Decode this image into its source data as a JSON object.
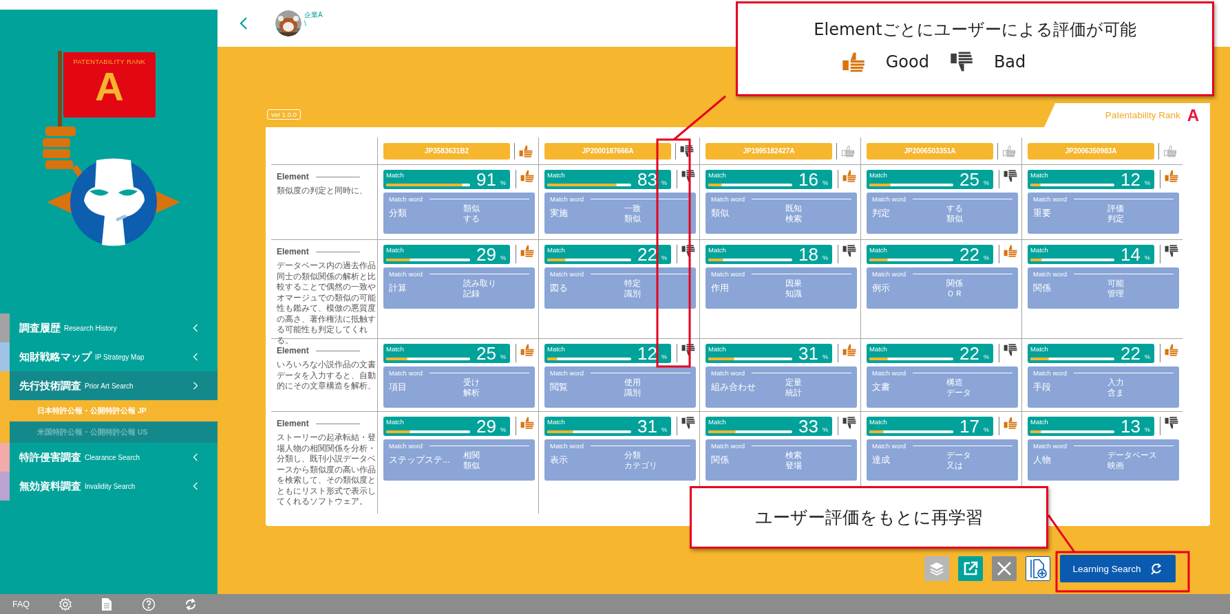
{
  "sidebar": {
    "logo": {
      "caption": "PATENTABILITY RANK",
      "letter": "A"
    },
    "menu": [
      {
        "label": "調査履歴",
        "sublabel": "Research History",
        "color": "#a3a3a3",
        "selected": false,
        "expanded": false
      },
      {
        "label": "知財戦略マップ",
        "sublabel": "IP Strategy Map",
        "color": "#9ec3e6",
        "selected": false,
        "expanded": false
      },
      {
        "label": "先行技術調査",
        "sublabel": "Prior Art Search",
        "color": "#f5b52e",
        "selected": true,
        "expanded": true,
        "children": [
          {
            "label": "日本特許公報・公開特許公報 JP",
            "selected": true
          },
          {
            "label": "米国特許公報・公開特許公報 US",
            "selected": false
          }
        ]
      },
      {
        "label": "特許侵害調査",
        "sublabel": "Clearance Search",
        "color": "#f2aaaa",
        "selected": false,
        "expanded": false
      },
      {
        "label": "無効資料調査",
        "sublabel": "Invalidity Search",
        "color": "#b9a4cf",
        "selected": false,
        "expanded": false
      }
    ]
  },
  "footer": {
    "faq": "FAQ"
  },
  "header": {
    "company": "企業A",
    "subtitle": "\\"
  },
  "version": "ver 1.0.0",
  "rank": {
    "label": "Patentability Rank",
    "letter": "A"
  },
  "patents": [
    {
      "number": "JP3583631B2",
      "good": true,
      "bad": false
    },
    {
      "number": "JP2000187666A",
      "good": false,
      "bad": true
    },
    {
      "number": "JP1995182427A",
      "good": false,
      "bad": false
    },
    {
      "number": "JP2006503351A",
      "good": false,
      "bad": false
    },
    {
      "number": "JP2006350983A",
      "good": false,
      "bad": false
    }
  ],
  "rows": [
    {
      "label": "Element",
      "description": "類似度の判定と同時に、",
      "cells": [
        {
          "match_label": "Match",
          "value": "91",
          "unit": "%",
          "level": 0.91,
          "good": true,
          "bad": false,
          "word_label": "Match word",
          "main": "分類",
          "words": [
            "類似",
            "する"
          ]
        },
        {
          "match_label": "Match",
          "value": "83",
          "unit": "%",
          "level": 0.83,
          "good": false,
          "bad": true,
          "word_label": "Match word",
          "main": "実施",
          "words": [
            "一致",
            "類似"
          ]
        },
        {
          "match_label": "Match",
          "value": "16",
          "unit": "%",
          "level": 0.16,
          "good": true,
          "bad": false,
          "word_label": "Match word",
          "main": "類似",
          "words": [
            "既知",
            "検索"
          ]
        },
        {
          "match_label": "Match",
          "value": "25",
          "unit": "%",
          "level": 0.25,
          "good": false,
          "bad": true,
          "word_label": "Match word",
          "main": "判定",
          "words": [
            "する",
            "類似"
          ]
        },
        {
          "match_label": "Match",
          "value": "12",
          "unit": "%",
          "level": 0.12,
          "good": true,
          "bad": false,
          "word_label": "Match word",
          "main": "重要",
          "words": [
            "評価",
            "判定"
          ]
        }
      ]
    },
    {
      "label": "Element",
      "description": "データベース内の過去作品同士の類似関係の解析と比較することで偶然の一致やオマージュでの類似の可能性も鑑みて、模倣の悪質度の高さ、著作権法に抵触する可能性も判定してくれる。",
      "cells": [
        {
          "match_label": "Match",
          "value": "29",
          "unit": "%",
          "level": 0.29,
          "good": true,
          "bad": false,
          "word_label": "Match word",
          "main": "計算",
          "words": [
            "読み取り",
            "記録"
          ]
        },
        {
          "match_label": "Match",
          "value": "22",
          "unit": "%",
          "level": 0.22,
          "good": false,
          "bad": true,
          "word_label": "Match word",
          "main": "図る",
          "words": [
            "特定",
            "識別"
          ]
        },
        {
          "match_label": "Match",
          "value": "18",
          "unit": "%",
          "level": 0.18,
          "good": false,
          "bad": true,
          "word_label": "Match word",
          "main": "作用",
          "words": [
            "因果",
            "知識"
          ]
        },
        {
          "match_label": "Match",
          "value": "22",
          "unit": "%",
          "level": 0.22,
          "good": true,
          "bad": false,
          "word_label": "Match word",
          "main": "例示",
          "words": [
            "関係",
            "ＯＲ"
          ]
        },
        {
          "match_label": "Match",
          "value": "14",
          "unit": "%",
          "level": 0.14,
          "good": false,
          "bad": true,
          "word_label": "Match word",
          "main": "関係",
          "words": [
            "可能",
            "管理"
          ]
        }
      ]
    },
    {
      "label": "Element",
      "description": "いろいろな小説作品の文書データを入力すると、自動的にその文章構造を解析、",
      "cells": [
        {
          "match_label": "Match",
          "value": "25",
          "unit": "%",
          "level": 0.25,
          "good": true,
          "bad": false,
          "word_label": "Match word",
          "main": "項目",
          "words": [
            "受け",
            "解析"
          ]
        },
        {
          "match_label": "Match",
          "value": "12",
          "unit": "%",
          "level": 0.12,
          "good": false,
          "bad": true,
          "word_label": "Match word",
          "main": "閲覧",
          "words": [
            "使用",
            "識別"
          ]
        },
        {
          "match_label": "Match",
          "value": "31",
          "unit": "%",
          "level": 0.31,
          "good": true,
          "bad": false,
          "word_label": "Match word",
          "main": "組み合わせ",
          "words": [
            "定量",
            "統計"
          ]
        },
        {
          "match_label": "Match",
          "value": "22",
          "unit": "%",
          "level": 0.22,
          "good": false,
          "bad": true,
          "word_label": "Match word",
          "main": "文書",
          "words": [
            "構造",
            "データ"
          ]
        },
        {
          "match_label": "Match",
          "value": "22",
          "unit": "%",
          "level": 0.22,
          "good": true,
          "bad": false,
          "word_label": "Match word",
          "main": "手段",
          "words": [
            "入力",
            "含ま"
          ]
        }
      ]
    },
    {
      "label": "Element",
      "description": "ストーリーの起承転結・登場人物の相関関係を分析・分類し、既刊小説データベースから類似度の高い作品を検索して、その類似度とともにリスト形式で表示してくれるソフトウェア。",
      "cells": [
        {
          "match_label": "Match",
          "value": "29",
          "unit": "%",
          "level": 0.29,
          "good": true,
          "bad": false,
          "word_label": "Match word",
          "main": "ステップステ...",
          "words": [
            "相関",
            "類似"
          ]
        },
        {
          "match_label": "Match",
          "value": "31",
          "unit": "%",
          "level": 0.31,
          "good": false,
          "bad": true,
          "word_label": "Match word",
          "main": "表示",
          "words": [
            "分類",
            "カテゴリ"
          ]
        },
        {
          "match_label": "Match",
          "value": "33",
          "unit": "%",
          "level": 0.33,
          "good": false,
          "bad": true,
          "word_label": "Match word",
          "main": "関係",
          "words": [
            "検索",
            "登場"
          ]
        },
        {
          "match_label": "Match",
          "value": "17",
          "unit": "%",
          "level": 0.17,
          "good": true,
          "bad": false,
          "word_label": "Match word",
          "main": "達成",
          "words": [
            "データ",
            "又は"
          ]
        },
        {
          "match_label": "Match",
          "value": "13",
          "unit": "%",
          "level": 0.13,
          "good": false,
          "bad": true,
          "word_label": "Match word",
          "main": "人物",
          "words": [
            "データベース",
            "映画"
          ]
        }
      ]
    }
  ],
  "learning_button": "Learning Search",
  "callouts": [
    {
      "text": "Elementごとにユーザーによる評価が可能",
      "items": [
        {
          "kind": "good",
          "label": "Good"
        },
        {
          "kind": "bad",
          "label": "Bad"
        }
      ]
    },
    {
      "text": "ユーザー評価をもとに再学習"
    }
  ]
}
